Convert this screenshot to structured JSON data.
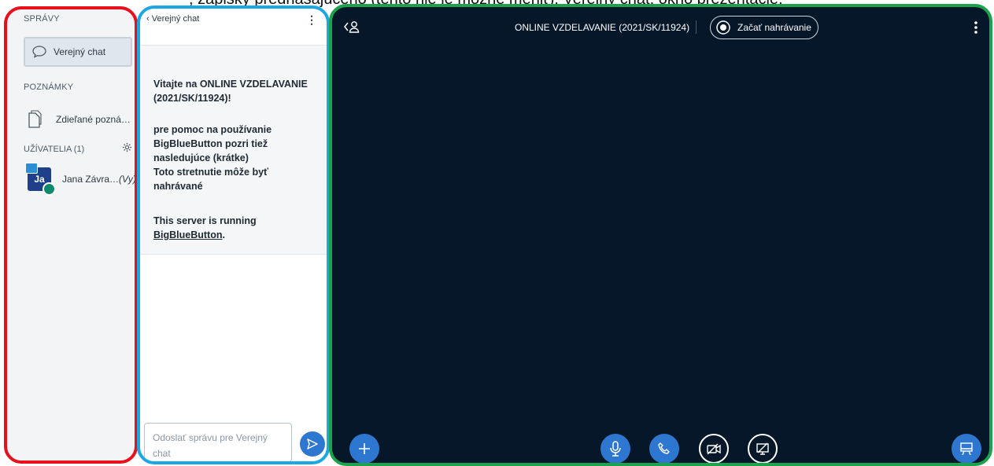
{
  "caption": "; zápisky prednášajúceho (tento nie je možné meniť); Verejný chat; okno prezentácie; ",
  "sidebar": {
    "messages_title": "SPRÁVY",
    "chat_label": "Verejný chat",
    "notes_title": "POZNÁMKY",
    "notes_label": "Zdieľané pozná…",
    "users_title": "UŽÍVATELIA (1)",
    "user_initials": "Ja",
    "user_name": "Jana Závra…",
    "user_you": "(Vy)"
  },
  "chat": {
    "header_title": "Verejný chat",
    "welcome_prefix": "Vitajte na ",
    "welcome_meeting": "ONLINE VZDELAVANIE (2021/SK/11924)",
    "welcome_suffix": "!",
    "help_text": "pre pomoc na používanie BigBlueButton pozri tiež nasledujúce (krátke)",
    "recording_text": "Toto stretnutie môže byť nahrávané",
    "server_text": "This server is running ",
    "server_link": "BigBlueButton",
    "server_suffix": ".",
    "input_placeholder": "Odoslať správu pre Verejný chat"
  },
  "main": {
    "meeting_title": "ONLINE VZDELAVANIE (2021/SK/11924)",
    "record_label": "Začať nahrávanie"
  },
  "colors": {
    "red_frame": "#e8101a",
    "blue_frame": "#1aa7e4",
    "green_frame": "#1aa34a",
    "main_bg": "#06172a",
    "accent_blue": "#2e77d0"
  }
}
